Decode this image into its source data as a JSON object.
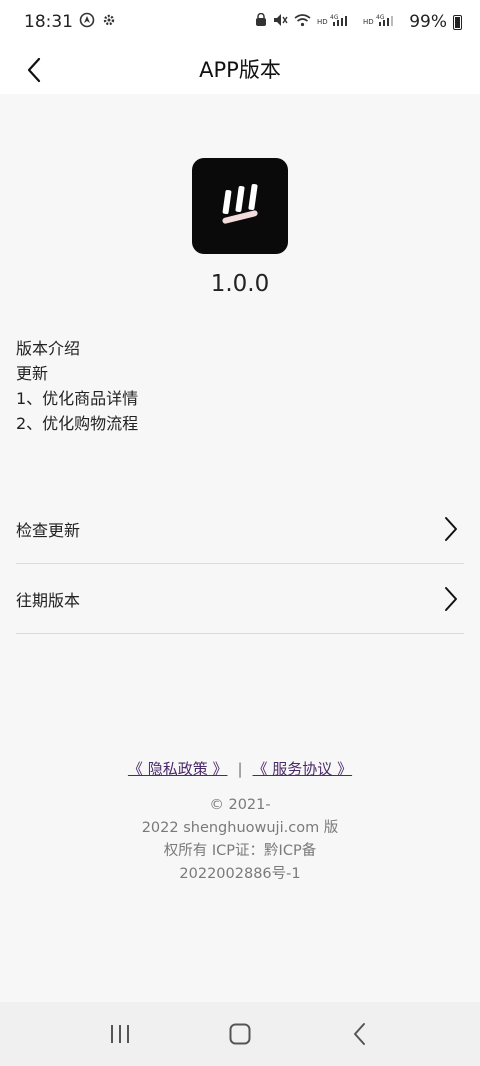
{
  "status": {
    "time": "18:31",
    "battery": "99%"
  },
  "header": {
    "title": "APP版本"
  },
  "app": {
    "version": "1.0.0"
  },
  "notes": {
    "heading": "版本介绍",
    "subheading": "更新",
    "items": [
      "1、优化商品详情",
      "2、优化购物流程"
    ]
  },
  "menu": {
    "items": [
      {
        "label": "检查更新"
      },
      {
        "label": "往期版本"
      }
    ]
  },
  "footer": {
    "privacy_link": "《 隐私政策 》",
    "separator": "|",
    "terms_link": "《 服务协议 》",
    "copyright_lines": [
      "© 2021-",
      "2022 shenghuowuji.com 版",
      "权所有 ICP证：黔ICP备",
      "2022002886号-1"
    ]
  }
}
